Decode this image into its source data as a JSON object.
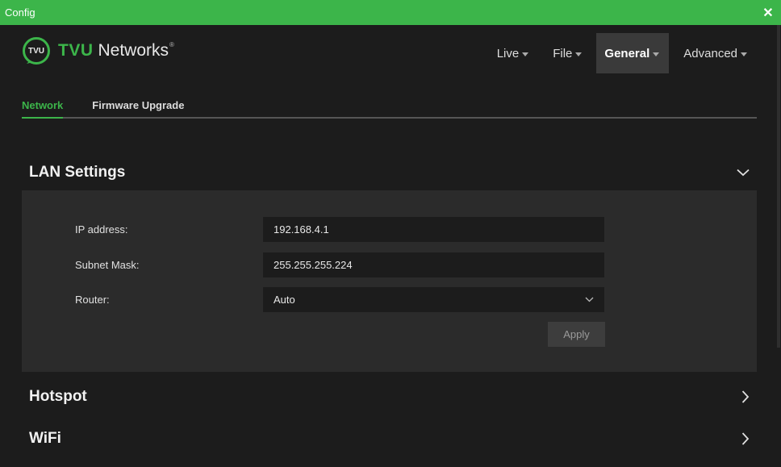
{
  "window": {
    "title": "Config",
    "close_glyph": "✕"
  },
  "brand": {
    "name_a": "TVU",
    "name_b": "Networks",
    "tm": "®",
    "logo_text": "TVU"
  },
  "nav": [
    {
      "label": "Live"
    },
    {
      "label": "File"
    },
    {
      "label": "General",
      "active": true
    },
    {
      "label": "Advanced"
    }
  ],
  "tabs": [
    {
      "label": "Network",
      "active": true
    },
    {
      "label": "Firmware Upgrade"
    }
  ],
  "lan": {
    "title": "LAN Settings",
    "ip_label": "IP address:",
    "ip_value": "192.168.4.1",
    "mask_label": "Subnet Mask:",
    "mask_value": "255.255.255.224",
    "router_label": "Router:",
    "router_value": "Auto",
    "apply_label": "Apply"
  },
  "sections": {
    "hotspot": "Hotspot",
    "wifi": "WiFi"
  },
  "colors": {
    "accent": "#3cb54a",
    "background": "#1c1c1c",
    "panel": "#2b2b2b"
  }
}
